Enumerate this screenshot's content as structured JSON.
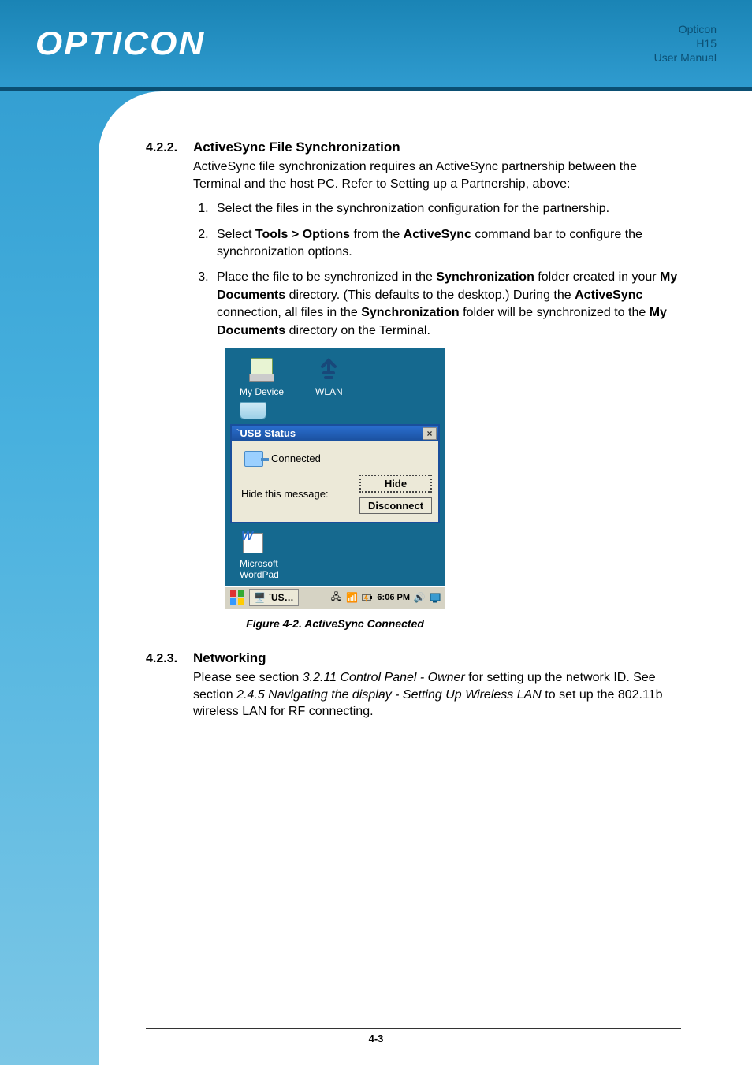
{
  "header": {
    "logo": "OPTICON",
    "brand": "Opticon",
    "model": "H15",
    "doc": "User Manual"
  },
  "section1": {
    "num": "4.2.2.",
    "title": "ActiveSync File Synchronization",
    "intro": "ActiveSync file synchronization requires an ActiveSync partnership between the Terminal and the host PC. Refer to Setting up a Partnership, above:",
    "step1": "Select the files in the synchronization configuration for the partnership.",
    "step2_pre": "Select ",
    "step2_b1": "Tools > Options",
    "step2_mid": " from the ",
    "step2_b2": "ActiveSync",
    "step2_post": " command bar to configure the synchronization options.",
    "step3_pre": "Place the file to be synchronized in the ",
    "step3_b1": "Synchronization",
    "step3_m1": " folder created in your ",
    "step3_b2": "My Documents",
    "step3_m2": " directory. (This defaults to the desktop.) During the ",
    "step3_b3": "ActiveSync",
    "step3_m3": " connection, all files in the ",
    "step3_b4": "Synchronization",
    "step3_m4": " folder will be synchronized to the ",
    "step3_b5": "My Documents",
    "step3_m5": " directory on the Terminal."
  },
  "device": {
    "desktop": {
      "my_device": "My Device",
      "wlan": "WLAN",
      "wordpad_l1": "Microsoft",
      "wordpad_l2": "WordPad"
    },
    "usb": {
      "title": "`USB Status",
      "connected": "Connected",
      "hide_label": "Hide this message:",
      "hide_btn": "Hide",
      "disconnect_btn": "Disconnect",
      "close": "×"
    },
    "taskbar": {
      "app": "`US…",
      "time": "6:06 PM"
    },
    "caption": "Figure 4-2. ActiveSync Connected"
  },
  "section2": {
    "num": "4.2.3.",
    "title": "Networking",
    "p_pre": "Please see section ",
    "p_i1": "3.2.11 Control Panel - Owner",
    "p_m1": " for setting up the network ID. See section ",
    "p_i2": "2.4.5 Navigating the display - Setting Up Wireless LAN",
    "p_post": " to set up the 802.11b wireless LAN for RF connecting."
  },
  "page_num": "4-3"
}
